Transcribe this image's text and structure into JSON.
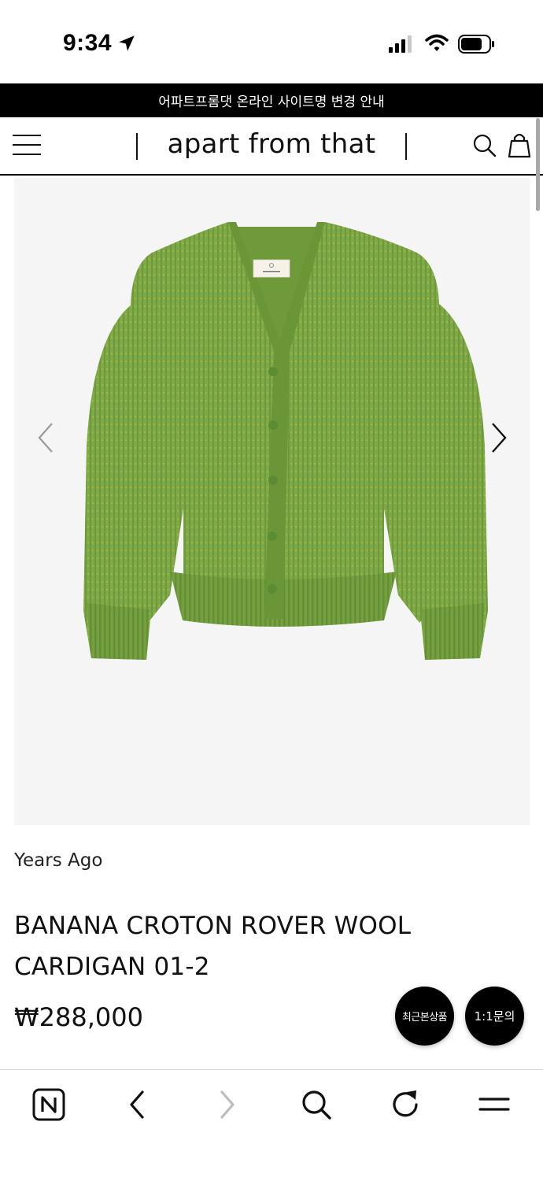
{
  "status_bar": {
    "time": "9:34"
  },
  "notice": {
    "text": "어파트프롬댓 온라인 사이트명 변경 안내"
  },
  "header": {
    "brand": "apart from that"
  },
  "product": {
    "brand": "Years Ago",
    "title": "BANANA CROTON ROVER WOOL CARDIGAN 01-2",
    "price": "₩288,000",
    "image_color": "#7fa846"
  },
  "floating": {
    "recent_label": "최근본상품",
    "inquiry_label": "1:1문의"
  },
  "colors": {
    "notice_bg": "#000000",
    "image_bg": "#f5f5f5",
    "cardigan_green": "#7fa846"
  }
}
